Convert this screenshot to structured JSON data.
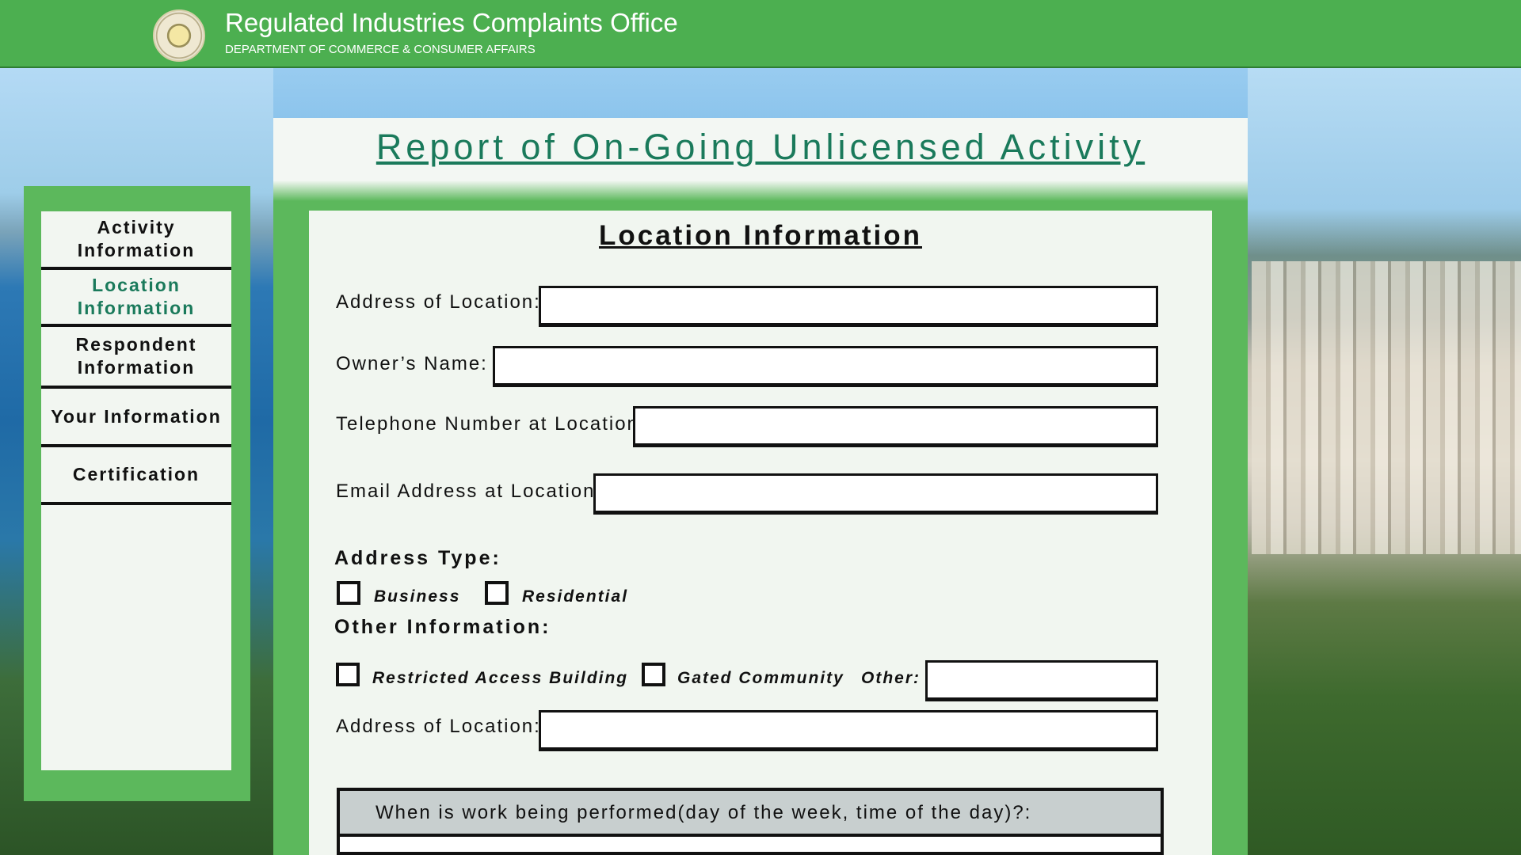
{
  "header": {
    "title": "Regulated Industries Complaints Office",
    "subtitle": "DEPARTMENT OF COMMERCE & CONSUMER AFFAIRS",
    "seal_icon": "state-seal-icon"
  },
  "sidebar": {
    "items": [
      {
        "label": "Activity Information",
        "active": false
      },
      {
        "label": "Location Information",
        "active": true
      },
      {
        "label": "Respondent Information",
        "active": false
      },
      {
        "label": "Your Information",
        "active": false
      },
      {
        "label": "Certification",
        "active": false
      }
    ]
  },
  "page": {
    "title": "Report of On-Going Unlicensed Activity",
    "section_title": "Location Information"
  },
  "form": {
    "address_label": "Address of Location:",
    "owner_label": "Owner’s Name:",
    "phone_label": "Telephone Number at Location:",
    "email_label": "Email Address at Location:",
    "address_type_heading": "Address Type:",
    "business_label": "Business",
    "residential_label": "Residential",
    "other_info_heading": "Other Information:",
    "restricted_label": "Restricted Access Building",
    "gated_label": "Gated Community",
    "other_label": "Other:",
    "address2_label": "Address of Location:",
    "question_text": "When is work being performed(day of the week, time of the day)?:"
  },
  "colors": {
    "header_green": "#4caf50",
    "panel_green": "#5cb85c",
    "accent_teal": "#1a7a5b"
  }
}
